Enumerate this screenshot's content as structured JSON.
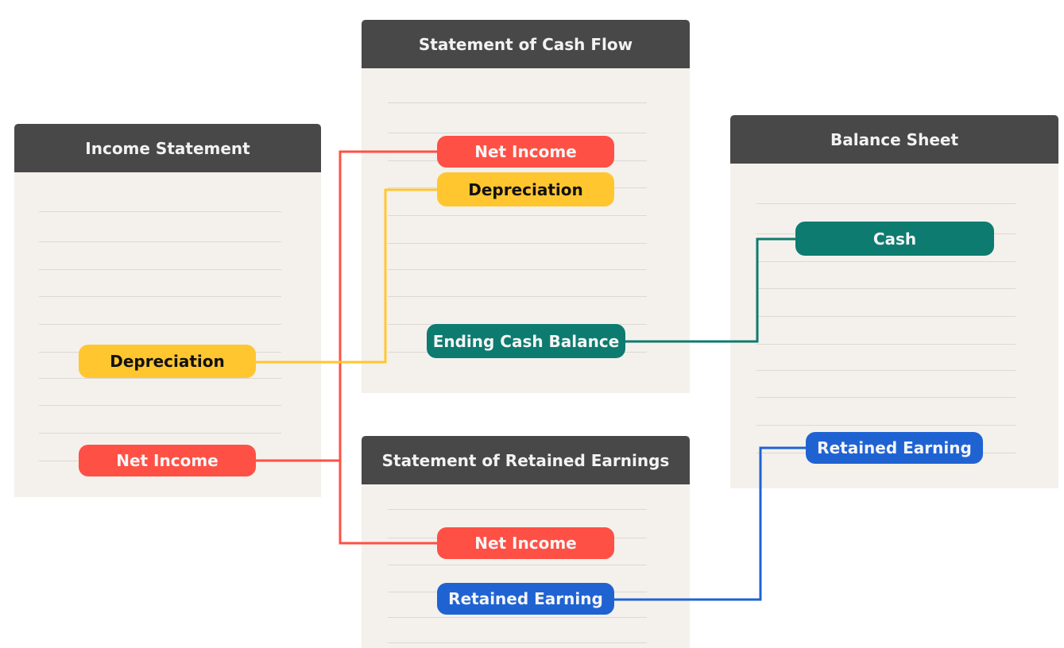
{
  "colors": {
    "header": "#484848",
    "panel": "#f4f1ec",
    "net_income": "#ff5045",
    "depreciation": "#ffc630",
    "cash": "#0d7b70",
    "retained_earning": "#1f63d3"
  },
  "panels": {
    "income_statement": {
      "title": "Income Statement",
      "items": [
        "Depreciation",
        "Net Income"
      ]
    },
    "cash_flow": {
      "title": "Statement of Cash Flow",
      "items": [
        "Net Income",
        "Depreciation",
        "Ending Cash Balance"
      ]
    },
    "balance_sheet": {
      "title": "Balance Sheet",
      "items": [
        "Cash",
        "Retained Earning"
      ]
    },
    "retained_earnings": {
      "title": "Statement of Retained Earnings",
      "items": [
        "Net Income",
        "Retained Earning"
      ]
    }
  },
  "connections": [
    {
      "from": "Income Statement: Net Income",
      "to": [
        "Statement of Cash Flow: Net Income",
        "Statement of Retained Earnings: Net Income"
      ],
      "color": "#ff5045"
    },
    {
      "from": "Income Statement: Depreciation",
      "to": [
        "Statement of Cash Flow: Depreciation"
      ],
      "color": "#ffc630"
    },
    {
      "from": "Statement of Cash Flow: Ending Cash Balance",
      "to": [
        "Balance Sheet: Cash"
      ],
      "color": "#0d7b70"
    },
    {
      "from": "Statement of Retained Earnings: Retained Earning",
      "to": [
        "Balance Sheet: Retained Earning"
      ],
      "color": "#1f63d3"
    }
  ]
}
